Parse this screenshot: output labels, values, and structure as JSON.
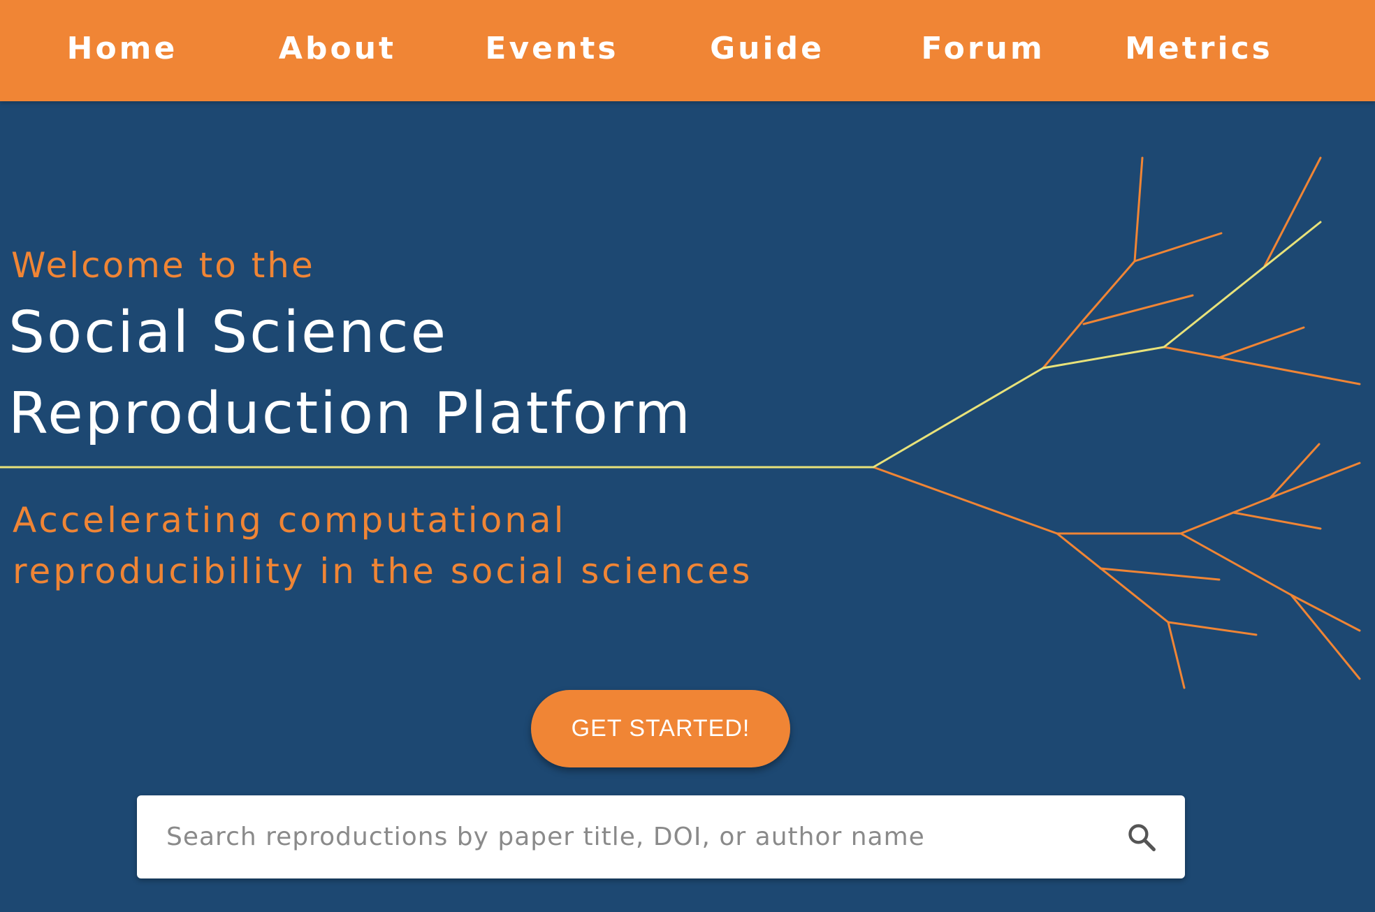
{
  "nav": {
    "items": [
      {
        "label": "Home"
      },
      {
        "label": "About"
      },
      {
        "label": "Events"
      },
      {
        "label": "Guide"
      },
      {
        "label": "Forum"
      },
      {
        "label": "Metrics"
      }
    ]
  },
  "hero": {
    "welcome": "Welcome to the",
    "title_line1": "Social Science",
    "title_line2": "Reproduction Platform",
    "subtitle_line1": "Accelerating computational",
    "subtitle_line2": "reproducibility in the social sciences",
    "cta_label": "GET STARTED!",
    "decoration_icon": "branching-tree-graphic"
  },
  "search": {
    "placeholder": "Search reproductions by paper title, DOI, or author name",
    "value": "",
    "icon": "search-icon"
  },
  "colors": {
    "nav_background": "#f08535",
    "hero_background": "#1d4872",
    "accent_orange": "#f08535",
    "branch_highlight": "#e8e27a",
    "text_white": "#ffffff",
    "placeholder_gray": "#8a8a8a"
  }
}
